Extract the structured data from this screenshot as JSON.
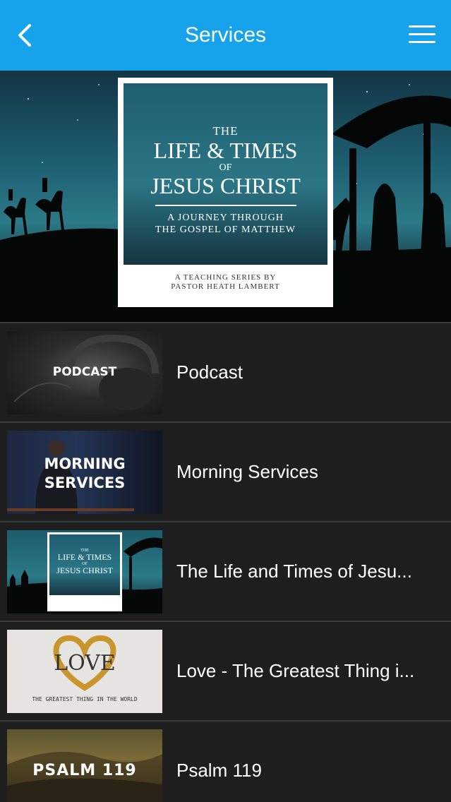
{
  "header": {
    "title": "Services",
    "background_color": "#16a3ec",
    "back_icon": "chevron-left-icon",
    "menu_icon": "hamburger-menu-icon"
  },
  "hero": {
    "poster": {
      "line1": "THE",
      "line2": "LIFE & TIMES",
      "line3": "OF",
      "line4": "JESUS CHRIST",
      "subtitle1": "A JOURNEY THROUGH",
      "subtitle2": "THE GOSPEL OF MATTHEW",
      "footer1": "A TEACHING SERIES BY",
      "footer2": "PASTOR HEATH LAMBERT"
    }
  },
  "items": [
    {
      "label": "Podcast",
      "thumb_text": "PODCAST"
    },
    {
      "label": "Morning Services",
      "thumb_text_1": "MORNING",
      "thumb_text_2": "SERVICES"
    },
    {
      "label": "The Life and Times of Jesu...",
      "thumb_text_1": "THE",
      "thumb_text_2": "LIFE & TIMES",
      "thumb_text_3": "OF",
      "thumb_text_4": "JESUS CHRIST"
    },
    {
      "label": "Love - The Greatest Thing i...",
      "thumb_text": "LOVE",
      "thumb_sub": "THE GREATEST THING IN THE WORLD"
    },
    {
      "label": "Psalm 119",
      "thumb_text": "PSALM 119"
    }
  ]
}
